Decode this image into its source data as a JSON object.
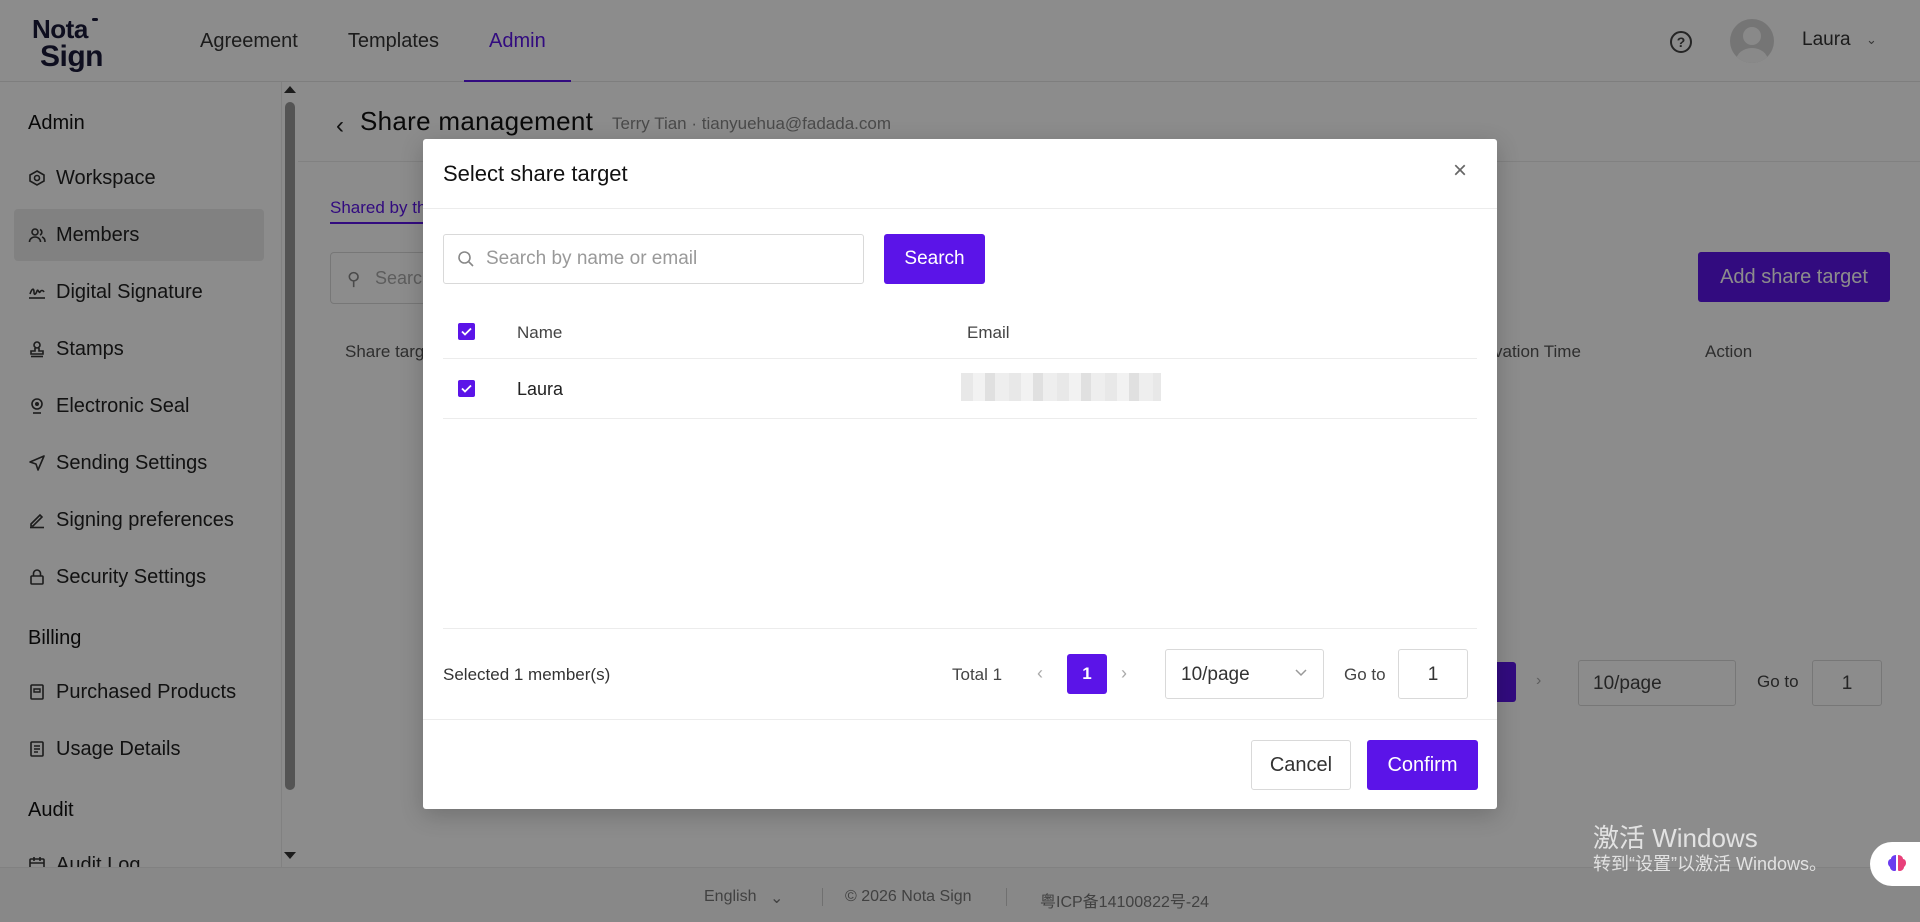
{
  "header": {
    "logo_top": "Nota",
    "logo_bottom": "Sign",
    "nav": [
      "Agreement",
      "Templates",
      "Admin"
    ],
    "active_nav": "Admin",
    "help_label": "?",
    "user_name": "Laura"
  },
  "sidebar": {
    "groups": [
      "Admin",
      "Billing",
      "Audit"
    ],
    "items": [
      {
        "label": "Workspace",
        "icon": "workspace-icon"
      },
      {
        "label": "Members",
        "icon": "members-icon",
        "active": true
      },
      {
        "label": "Digital Signature",
        "icon": "signature-icon"
      },
      {
        "label": "Stamps",
        "icon": "stamp-icon"
      },
      {
        "label": "Electronic Seal",
        "icon": "seal-icon"
      },
      {
        "label": "Sending Settings",
        "icon": "send-icon"
      },
      {
        "label": "Signing preferences",
        "icon": "pen-icon"
      },
      {
        "label": "Security Settings",
        "icon": "lock-icon"
      },
      {
        "label": "Purchased Products",
        "icon": "product-icon"
      },
      {
        "label": "Usage Details",
        "icon": "document-icon"
      },
      {
        "label": "Audit Log",
        "icon": "calendar-icon"
      }
    ]
  },
  "page": {
    "title": "Share management",
    "subtitle": "Terry Tian · tianyuehua@fadada.com",
    "tab_shared": "Shared by th",
    "search_placeholder": "Searc",
    "add_button": "Add share target",
    "columns": [
      "Share targ",
      "vation Time",
      "Action"
    ],
    "page_size": "10/page",
    "goto_label": "Go to",
    "goto_value": "1"
  },
  "footer": {
    "language": "English",
    "copyright": "© 2026 Nota Sign",
    "icp": "粤ICP备14100822号-24"
  },
  "modal": {
    "title": "Select share target",
    "search_placeholder": "Search by name or email",
    "search_button": "Search",
    "columns": {
      "name": "Name",
      "email": "Email"
    },
    "rows": [
      {
        "name": "Laura",
        "checked": true
      }
    ],
    "selected_text": "Selected 1 member(s)",
    "total_text": "Total 1",
    "current_page": "1",
    "page_size": "10/page",
    "goto_label": "Go to",
    "goto_value": "1",
    "cancel_label": "Cancel",
    "confirm_label": "Confirm"
  },
  "watermark": {
    "line1": "激活 Windows",
    "line2": "转到“设置”以激活 Windows。"
  },
  "colors": {
    "accent": "#5b14e8"
  }
}
